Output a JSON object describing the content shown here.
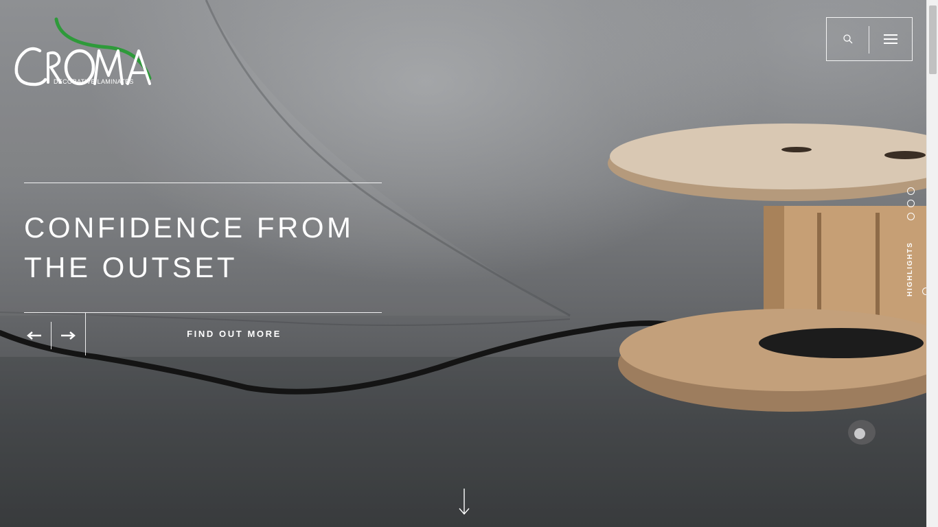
{
  "brand": {
    "name": "CROMA",
    "tagline": "DECORATIVE LAMINATES",
    "accent_color": "#2e9a3a"
  },
  "header": {
    "search_icon": "search-icon",
    "menu_icon": "hamburger-menu-icon"
  },
  "hero": {
    "headline_line1": "CONFIDENCE FROM",
    "headline_line2": "THE OUTSET",
    "cta_label": "FIND OUT MORE",
    "prev_icon": "arrow-left-icon",
    "next_icon": "arrow-right-icon"
  },
  "side_nav": {
    "section_label": "HIGHLIGHTS",
    "dots": 3
  },
  "scroll_hint": {
    "icon": "arrow-down-icon"
  }
}
